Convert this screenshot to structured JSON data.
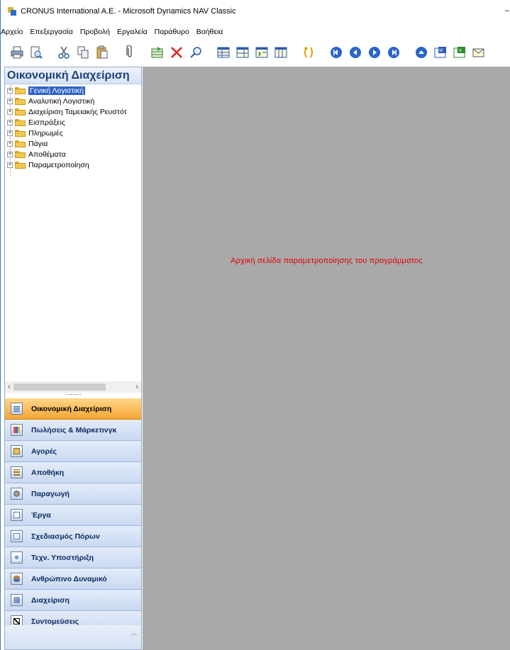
{
  "window": {
    "title": "CRONUS International A.E. - Microsoft Dynamics NAV Classic",
    "minimize_glyph": "–"
  },
  "menubar": {
    "items": [
      "Αρχείο",
      "Επεξεργασία",
      "Προβολή",
      "Εργαλεία",
      "Παράθυρο",
      "Βοήθεια"
    ]
  },
  "toolbar": {
    "icons": [
      "print-icon",
      "print-preview-icon",
      "cut-icon",
      "copy-icon",
      "paste-icon",
      "attach-icon",
      "new-record-icon",
      "delete-icon",
      "find-icon",
      "list-icon",
      "card-icon",
      "sort-icon",
      "filter-icon",
      "refresh-icon",
      "first-record-icon",
      "previous-record-icon",
      "next-record-icon",
      "last-record-icon",
      "up-icon",
      "export-word-icon",
      "export-excel-icon",
      "send-mail-icon"
    ]
  },
  "navpane": {
    "header": "Οικονομική Διαχείριση",
    "tree": [
      {
        "label": "Γενική Λογιστική",
        "selected": true
      },
      {
        "label": "Αναλυτική Λογιστική",
        "selected": false
      },
      {
        "label": "Διαχείριση Ταμειακής Ρευστότ",
        "selected": false
      },
      {
        "label": "Εισπράξεις",
        "selected": false
      },
      {
        "label": "Πληρωμές",
        "selected": false
      },
      {
        "label": "Πάγια",
        "selected": false
      },
      {
        "label": "Αποθέματα",
        "selected": false
      },
      {
        "label": "Παραμετροποίηση",
        "selected": false
      }
    ],
    "expander_glyph": "+",
    "scroll_left": "‹",
    "scroll_right": "›",
    "splitter_dots": "⋯⋯⋯",
    "sections": [
      {
        "label": "Οικονομική Διαχείριση",
        "icon": "finance-icon",
        "active": true
      },
      {
        "label": "Πωλήσεις & Μάρκετινγκ",
        "icon": "sales-icon",
        "active": false
      },
      {
        "label": "Αγορές",
        "icon": "purchases-icon",
        "active": false
      },
      {
        "label": "Αποθήκη",
        "icon": "warehouse-icon",
        "active": false
      },
      {
        "label": "Παραγωγή",
        "icon": "manufacturing-icon",
        "active": false
      },
      {
        "label": "Έργα",
        "icon": "jobs-icon",
        "active": false
      },
      {
        "label": "Σχεδιασμός Πόρων",
        "icon": "resource-planning-icon",
        "active": false
      },
      {
        "label": "Τεχν. Υποστήριξη",
        "icon": "service-icon",
        "active": false
      },
      {
        "label": "Ανθρώπινο Δυναμικό",
        "icon": "human-resources-icon",
        "active": false
      },
      {
        "label": "Διαχείριση",
        "icon": "administration-icon",
        "active": false
      },
      {
        "label": "Συντομεύσεις",
        "icon": "shortcuts-icon",
        "active": false
      }
    ],
    "bottom_chevron": "︿"
  },
  "main": {
    "message": "Αρχική σελίδα παραμετροποίησης του προγράμματος"
  },
  "colors": {
    "main_background": "#a9a9a9",
    "message": "#e00000",
    "active_section": "#f6a533",
    "selected_tree_item": "#2f63c6",
    "header_text": "#1f3f7a"
  }
}
